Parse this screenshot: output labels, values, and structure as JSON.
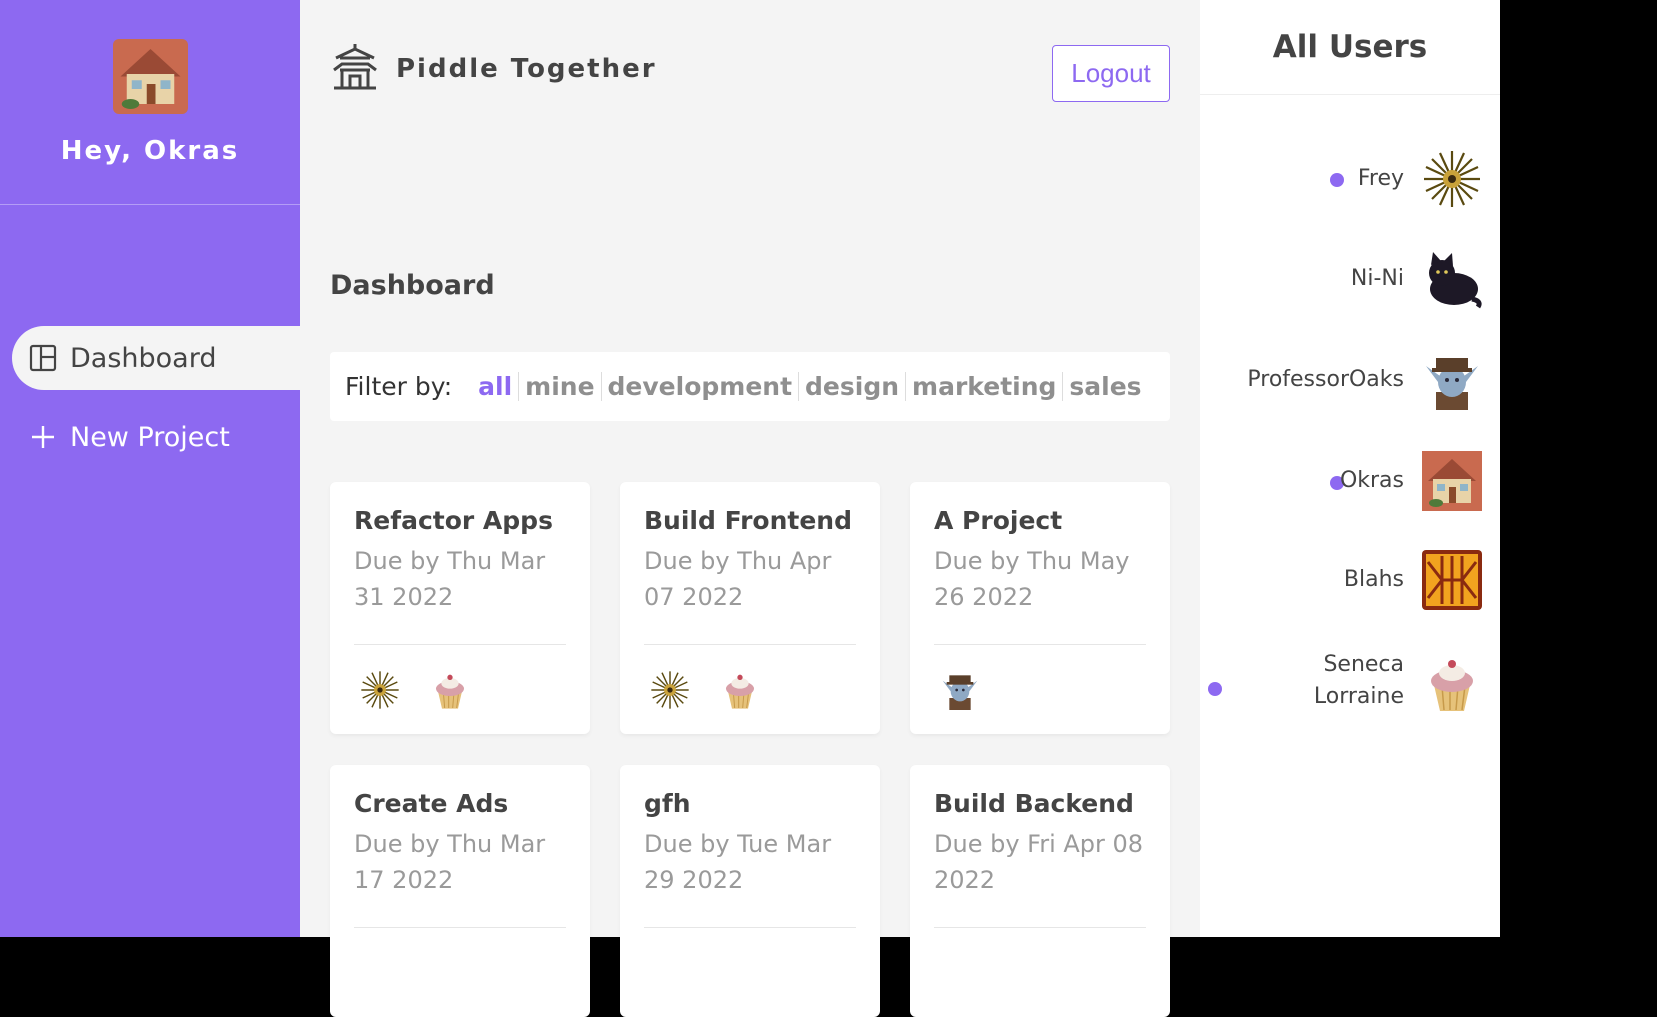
{
  "sidebar": {
    "greeting": "Hey, Okras",
    "nav": [
      {
        "label": "Dashboard",
        "icon": "layout-icon",
        "active": true
      },
      {
        "label": "New Project",
        "icon": "plus-icon",
        "active": false
      }
    ]
  },
  "header": {
    "brand": "Piddle Together",
    "logout_label": "Logout"
  },
  "main": {
    "title": "Dashboard",
    "filter": {
      "label": "Filter by:",
      "options": [
        "all",
        "mine",
        "development",
        "design",
        "marketing",
        "sales"
      ],
      "selected": "all"
    },
    "projects": [
      {
        "name": "Refactor Apps",
        "due": "Due by Thu Mar 31 2022"
      },
      {
        "name": "Build Frontend",
        "due": "Due by Thu Apr 07 2022"
      },
      {
        "name": "A Project",
        "due": "Due by Thu May 26 2022"
      },
      {
        "name": "Create Ads",
        "due": "Due by Thu Mar 17 2022"
      },
      {
        "name": "gfh",
        "due": "Due by Tue Mar 29 2022"
      },
      {
        "name": "Build Backend",
        "due": "Due by Fri Apr 08 2022"
      }
    ]
  },
  "users_panel": {
    "title": "All Users",
    "users": [
      {
        "name": "Frey",
        "online": true
      },
      {
        "name": "Ni-Ni",
        "online": false
      },
      {
        "name": "ProfessorOaks",
        "online": false
      },
      {
        "name": "Okras",
        "online": true
      },
      {
        "name": "Blahs",
        "online": false
      },
      {
        "name": "Seneca Lorraine",
        "online": true
      }
    ]
  },
  "colors": {
    "accent": "#8d69f1",
    "background": "#f4f4f4"
  }
}
